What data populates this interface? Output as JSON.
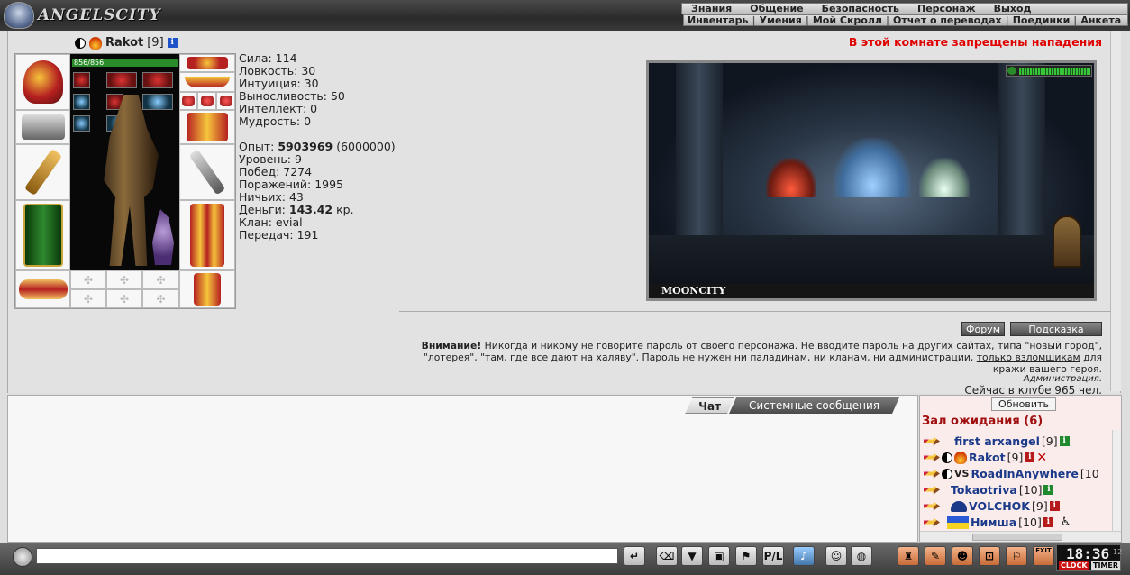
{
  "header": {
    "logo_text": "ANGELSCITY",
    "menu_top": [
      "Знания",
      "Общение",
      "Безопасность",
      "Персонаж",
      "Выход"
    ],
    "menu_sub": [
      "Инвентарь",
      "Умения",
      "Мой Скролл",
      "Отчет о переводах",
      "Поединки",
      "Анкета"
    ]
  },
  "character": {
    "name": "Rakot",
    "level": "[9]",
    "hp": "856/856",
    "stats": [
      "Сила: 114",
      "Ловкость: 30",
      "Интуиция: 30",
      "Выносливость: 50",
      "Интеллект: 0",
      "Мудрость: 0"
    ],
    "exp_label": "Опыт: ",
    "exp_value": "5903969",
    "exp_next": " (6000000)",
    "level_line": "Уровень: 9",
    "wins": "Побед: 7274",
    "losses": "Поражений: 1995",
    "draws": "Ничьих: 43",
    "money_label": "Деньги: ",
    "money_value": "143.42",
    "money_unit": " кр.",
    "clan": "Клан: evial",
    "transfers": "Передач: 191"
  },
  "room": {
    "warning": "В этой комнате запрещены нападения",
    "name": "MOONCITY"
  },
  "buttons": {
    "forum": "Форум",
    "hint": "Подсказка",
    "refresh": "Обновить"
  },
  "notice": {
    "bold": "Внимание!",
    "text1": " Никогда и никому не говорите пароль от своего персонажа. Не вводите пароль на других сайтах, типа \"новый город\", \"лотерея\", \"там, где все дают на халяву\". Пароль не нужен ни паладинам, ни кланам, ни администрации, ",
    "link": "только взломщикам",
    "text2": " для кражи вашего героя.",
    "sign": "Администрация.",
    "club": "Сейчас в клубе 965 чел."
  },
  "chat": {
    "tabs": [
      "Чат",
      "Системные сообщения"
    ],
    "input_value": ""
  },
  "users": {
    "room_title": "Зал ожидания (6)",
    "list": [
      {
        "name": "first arxangel",
        "level": "[9]"
      },
      {
        "name": "Rakot",
        "level": "[9]"
      },
      {
        "name": "RoadInAnywhere",
        "level": "[10"
      },
      {
        "name": "Tokaotriva",
        "level": "[10]"
      },
      {
        "name": "VOLCHOK",
        "level": "[9]"
      },
      {
        "name": "Нимша",
        "level": "[10]"
      }
    ]
  },
  "bottom": {
    "exit_label": "EXIT",
    "clock_time": "18:36",
    "clock_sec": "12",
    "clock_label": "CLOCK",
    "timer_label": "TIMER",
    "tool_pl": "P/L"
  }
}
